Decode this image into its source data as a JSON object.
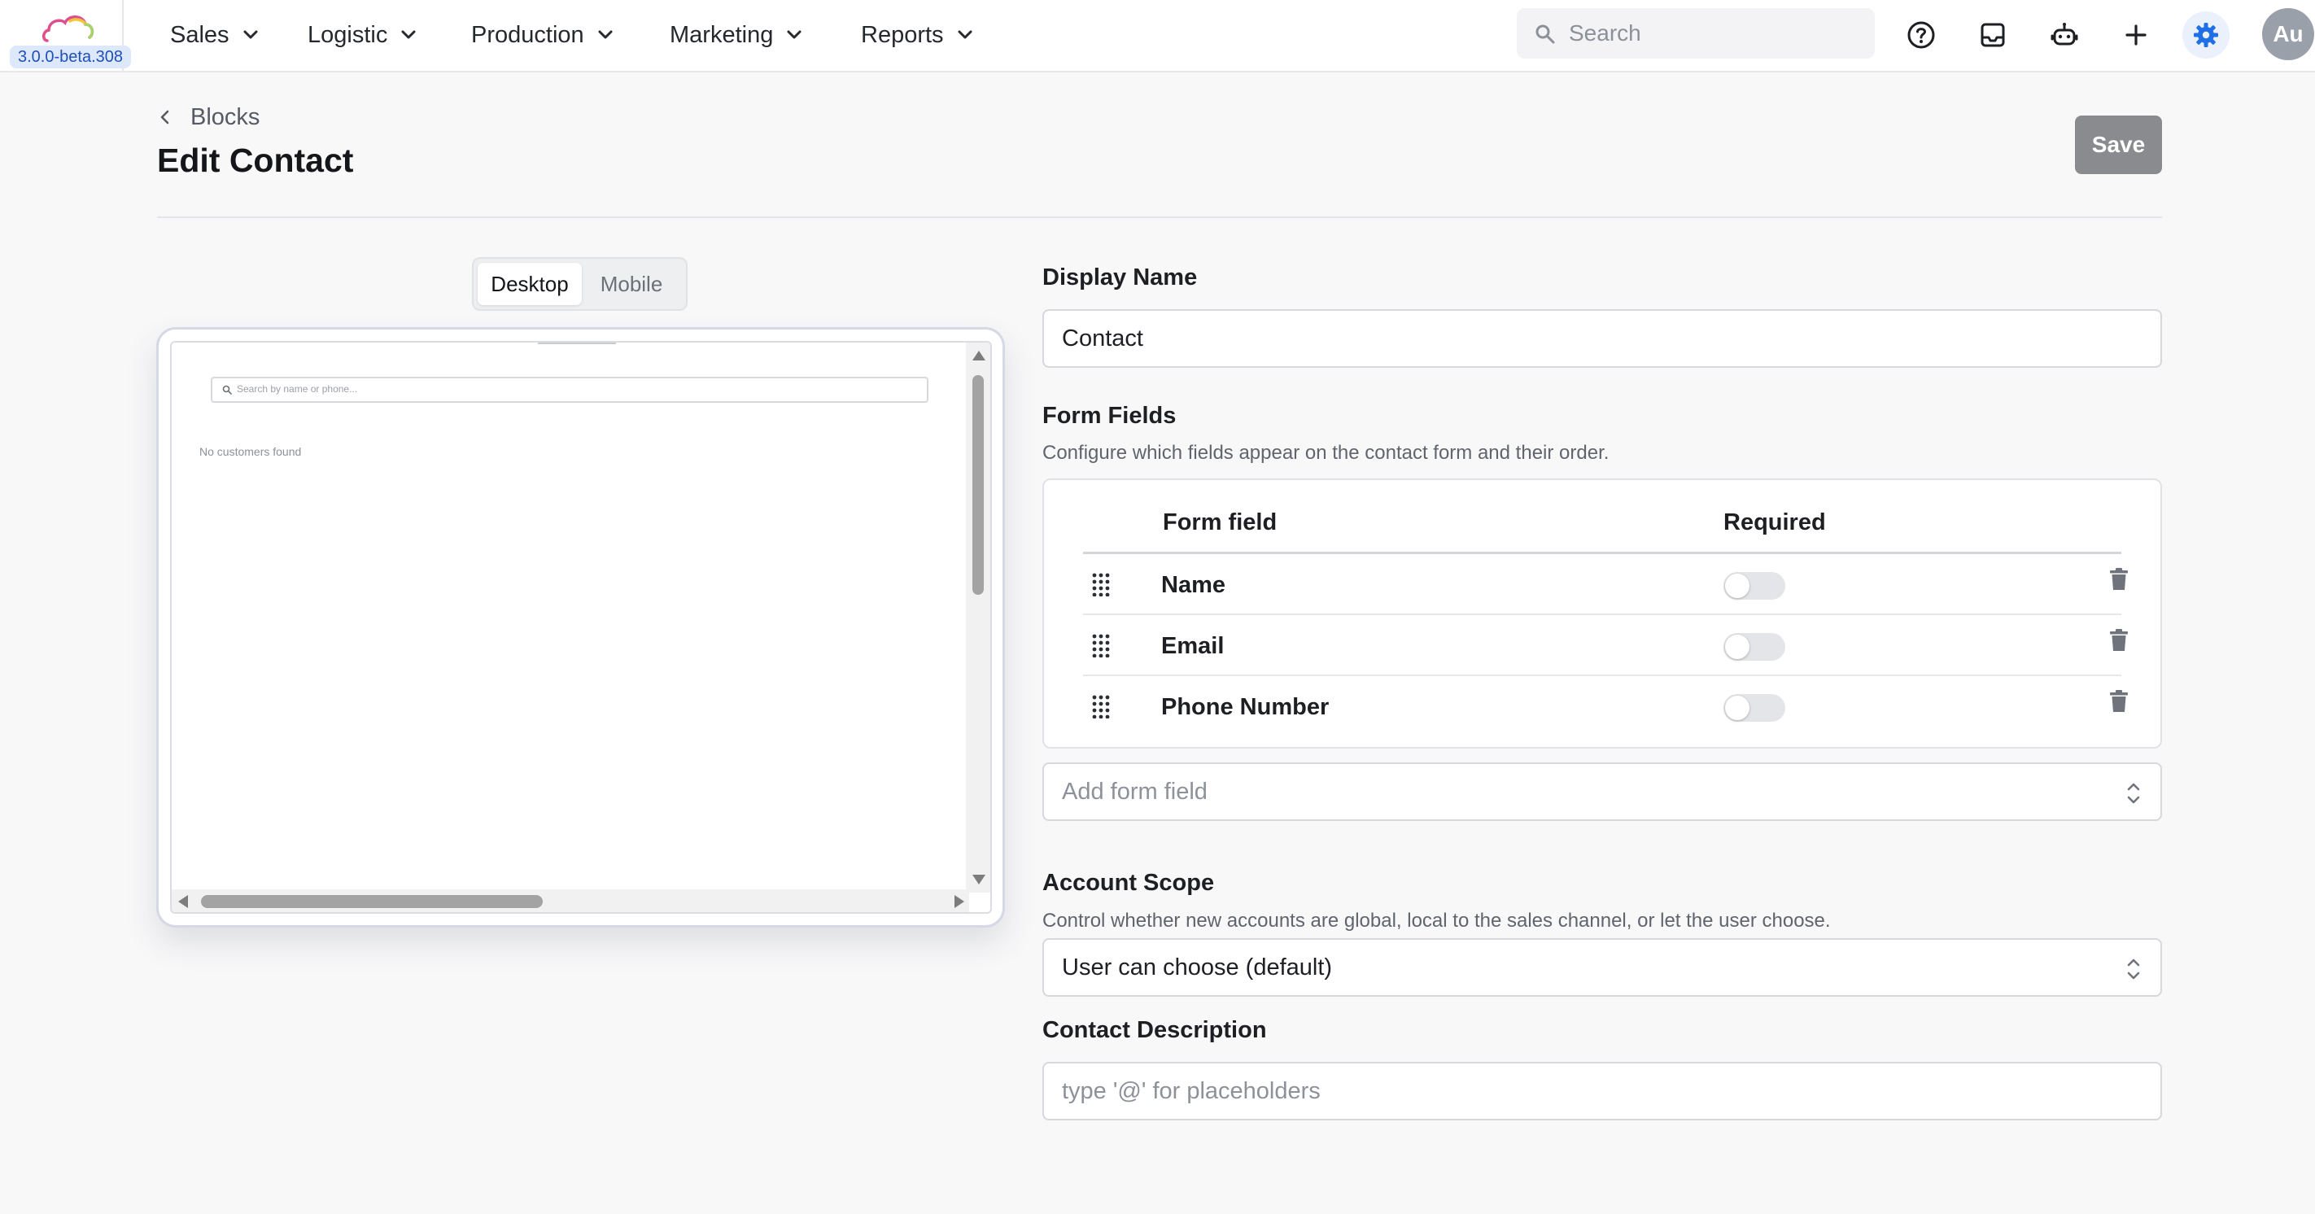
{
  "app": {
    "version": "3.0.0-beta.308",
    "brand_colors": {
      "accent": "#1f6fe6",
      "save_button": "#8a8b8e"
    }
  },
  "nav": {
    "items": [
      {
        "label": "Sales",
        "icon": "chevron-down-icon"
      },
      {
        "label": "Logistic",
        "icon": "chevron-down-icon"
      },
      {
        "label": "Production",
        "icon": "chevron-down-icon"
      },
      {
        "label": "Marketing",
        "icon": "chevron-down-icon"
      },
      {
        "label": "Reports",
        "icon": "chevron-down-icon"
      }
    ]
  },
  "search": {
    "placeholder": "Search",
    "value": ""
  },
  "toolbar_icons": [
    "help-circle-icon",
    "inbox-icon",
    "robot-icon",
    "plus-icon",
    "gear-icon"
  ],
  "user": {
    "initials": "Au"
  },
  "page": {
    "breadcrumb": "Blocks",
    "title": "Edit Contact",
    "save_label": "Save"
  },
  "preview": {
    "tabs": [
      {
        "label": "Desktop",
        "active": true
      },
      {
        "label": "Mobile",
        "active": false
      }
    ],
    "search_placeholder": "Search by name or phone...",
    "empty_message": "No customers found"
  },
  "form": {
    "display_name": {
      "label": "Display Name",
      "value": "Contact"
    },
    "form_fields": {
      "label": "Form Fields",
      "hint": "Configure which fields appear on the contact form and their order.",
      "columns": {
        "field": "Form field",
        "required": "Required"
      },
      "rows": [
        {
          "name": "Name",
          "required": false
        },
        {
          "name": "Email",
          "required": false
        },
        {
          "name": "Phone Number",
          "required": false
        }
      ],
      "add_placeholder": "Add form field"
    },
    "account_scope": {
      "label": "Account Scope",
      "hint": "Control whether new accounts are global, local to the sales channel, or let the user choose.",
      "value": "User can choose (default)"
    },
    "contact_description": {
      "label": "Contact Description",
      "placeholder": "type '@' for placeholders",
      "value": ""
    }
  }
}
